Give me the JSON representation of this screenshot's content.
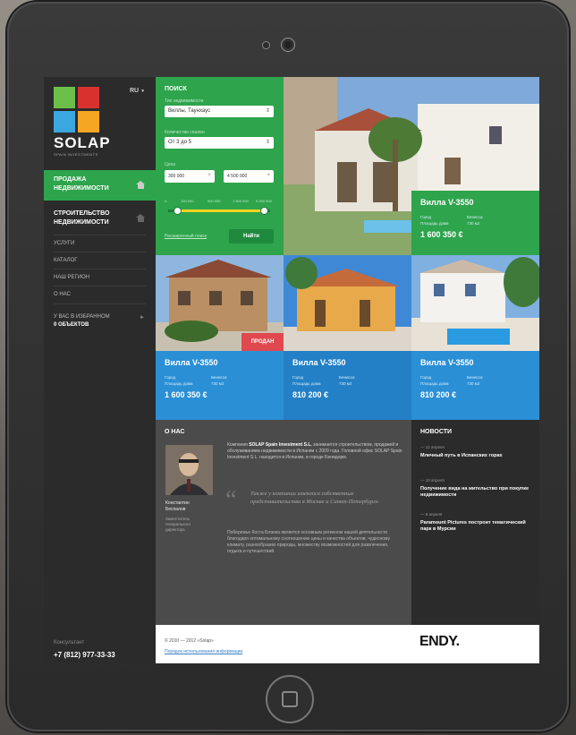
{
  "colors": {
    "green": "#2ea44c",
    "blue": "#2b8fd6",
    "dark": "#2b2b2b",
    "gray": "#4b4b4b",
    "sold": "#e0484f"
  },
  "sidebar": {
    "lang": "RU",
    "brand": "SOLAP",
    "brand_sub": "SPAIN INVESTMENTS",
    "nav_big": [
      {
        "label": "ПРОДАЖА НЕДВИЖИМОСТИ",
        "icon": "house-icon",
        "active": true
      },
      {
        "label": "СТРОИТЕЛЬСТВО НЕДВИЖИМОСТИ",
        "icon": "house-icon",
        "active": false
      }
    ],
    "nav_small": [
      "УСЛУГИ",
      "КАТАЛОГ",
      "НАШ РЕГИОН",
      "О НАС"
    ],
    "favorites_line1": "У ВАС В ИЗБРАННОМ",
    "favorites_line2": "0 ОБЪЕКТОВ",
    "consult_label": "Консультант",
    "phone": "+7 (812) 977-33-33"
  },
  "search": {
    "title": "ПОИСК",
    "type_label": "Тип недвижимости",
    "type_value": "Виллы, Таунхаус",
    "rooms_label": "Количество спален",
    "rooms_value": "От 3 до 5",
    "price_label": "Цена",
    "price_from": "300 000",
    "price_to": "4 500 000",
    "ticks": [
      "0",
      "150 000",
      "500 000",
      "1 500 000",
      "5 000 000"
    ],
    "advanced": "Расширенный поиск",
    "find_button": "Найти"
  },
  "listings": [
    {
      "title": "Вилла V-3550",
      "spec_l1": "Город",
      "spec_l2": "Площадь дома",
      "spec_v1": "Бенисса",
      "spec_v2": "730 м2",
      "price": "1 600 350 €"
    },
    {
      "title": "Вилла V-3550",
      "spec_l1": "Город",
      "spec_l2": "Площадь дома",
      "spec_v1": "Бенисса",
      "spec_v2": "730 м2",
      "price": "1 600 350 €",
      "badge": "ПРОДАН"
    },
    {
      "title": "Вилла V-3550",
      "spec_l1": "Город",
      "spec_l2": "Площадь дома",
      "spec_v1": "Бенисса",
      "spec_v2": "730 м2",
      "price": "810 200 €"
    },
    {
      "title": "Вилла V-3550",
      "spec_l1": "Город",
      "spec_l2": "Площадь дома",
      "spec_v1": "Бенисса",
      "spec_v2": "730 м2",
      "price": "810 200 €"
    }
  ],
  "about": {
    "heading": "О НАС",
    "person_name": "Константин Беспалов",
    "person_role": "Заместитель генерального директора",
    "text_pre": "Компания ",
    "text_bold": "SOLAP Spain Investment S.L.",
    "text_post": " занимается строительством, продажей и обслуживанием недвижимости в Испании с 2009 года. Головной офис SOLAP Spain Investment S.L. находится в Испании, в городе Бенидорм.",
    "quote": "Также у компании имеются собственные представительства в Москве и Санкт-Петербурге.",
    "text2": "Побережье Коста Бланка является основным регионом нашей деятельности благодаря оптимальному соотношению цены и качества объектов, чудесному климату, разнообразию природы, множеству возможностей для развлечения, отдыха и путешествий."
  },
  "news": {
    "heading": "НОВОСТИ",
    "items": [
      {
        "date": "— 12 апреля",
        "title": "Млечный путь в Испанских горах"
      },
      {
        "date": "— 10 апреля",
        "title": "Получение вида на жительство при покупке недвижимости"
      },
      {
        "date": "— 8 апреля",
        "title": "Paramount Pictures построит тематический парк в Мурсии"
      }
    ]
  },
  "footer": {
    "copyright": "© 2010 — 2012 «Solap»",
    "policy": "Порядок использования информации",
    "dev_logo": "ENDY."
  }
}
